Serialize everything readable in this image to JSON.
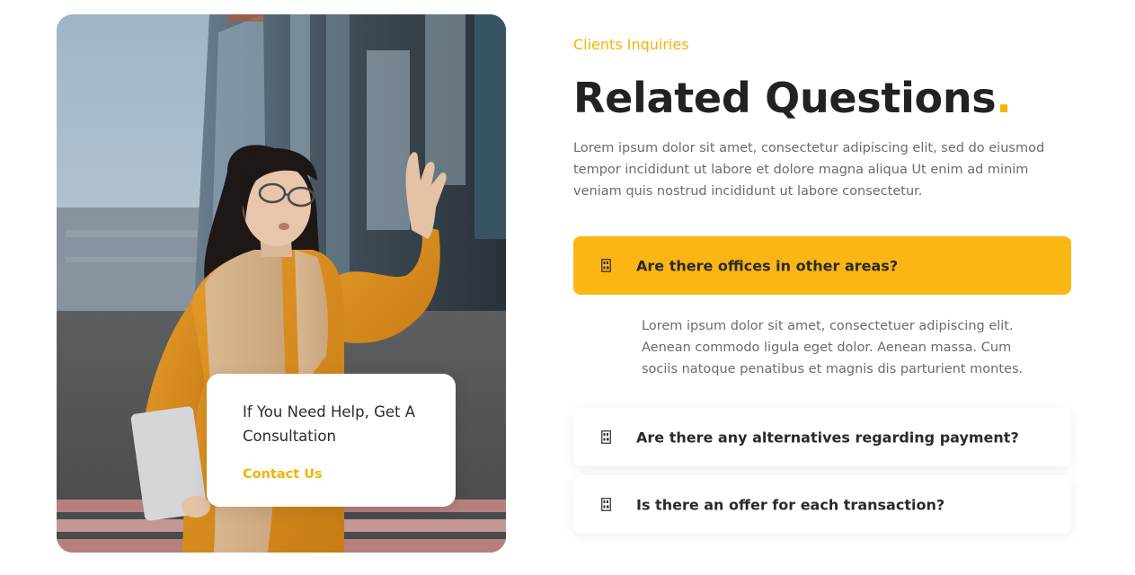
{
  "promo": {
    "title": "If You Need Help, Get A Consultation",
    "link": "Contact Us"
  },
  "section": {
    "kicker": "Clients Inquiries",
    "heading": "Related Questions",
    "heading_dot": ".",
    "intro": "Lorem ipsum dolor sit amet, consectetur adipiscing elit, sed do eiusmod tempor incididunt ut labore et dolore magna aliqua Ut enim ad minim veniam quis nostrud incididunt ut labore consectetur."
  },
  "faqs": [
    {
      "question": "Are there offices in other areas?",
      "icon": "expanded-glyph-icon",
      "expanded": true,
      "answer": "Lorem ipsum dolor sit amet, consectetuer adipiscing elit. Aenean commodo ligula eget dolor. Aenean massa. Cum sociis natoque penatibus et magnis dis parturient montes."
    },
    {
      "question": "Are there any alternatives regarding payment?",
      "icon": "collapsed-glyph-icon",
      "expanded": false
    },
    {
      "question": "Is there an offer for each transaction?",
      "icon": "collapsed-glyph-icon",
      "expanded": false
    }
  ],
  "colors": {
    "accent": "#fbb614",
    "heading": "#222222",
    "body_text": "#6b6b6b"
  }
}
